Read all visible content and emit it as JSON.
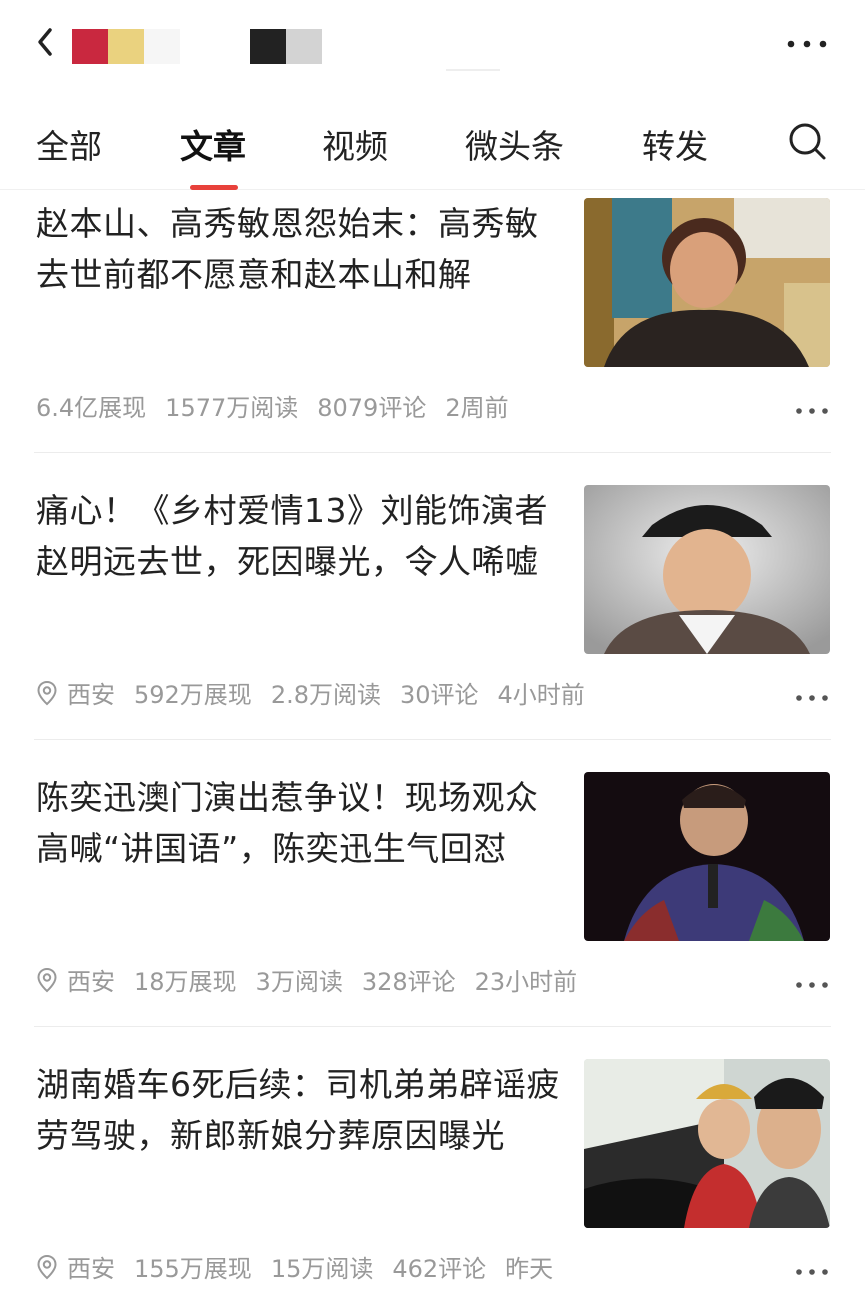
{
  "header": {
    "back_icon": "chevron-left-icon",
    "more_icon": "more-horizontal-icon",
    "swatches": [
      {
        "color": "#c9283f"
      },
      {
        "color": "#ead27f"
      },
      {
        "color": "#f6f6f6"
      },
      {
        "color": "#222222"
      },
      {
        "color": "#d3d3d3"
      }
    ]
  },
  "tabs": [
    {
      "label": "全部"
    },
    {
      "label": "文章",
      "active": true
    },
    {
      "label": "视频"
    },
    {
      "label": "微头条"
    },
    {
      "label": "转发"
    }
  ],
  "accent_color": "#e8413b",
  "articles": [
    {
      "title": "赵本山、高秀敏恩怨始末：高秀敏去世前都不愿意和赵本山和解",
      "location": "",
      "impressions": "6.4亿展现",
      "reads": "1577万阅读",
      "comments": "8079评论",
      "time": "2周前"
    },
    {
      "title": "痛心！《乡村爱情13》刘能饰演者赵明远去世，死因曝光，令人唏嘘",
      "location": "西安",
      "impressions": "592万展现",
      "reads": "2.8万阅读",
      "comments": "30评论",
      "time": "4小时前"
    },
    {
      "title": "陈奕迅澳门演出惹争议！现场观众高喊“讲国语”，陈奕迅生气回怼",
      "location": "西安",
      "impressions": "18万展现",
      "reads": "3万阅读",
      "comments": "328评论",
      "time": "23小时前"
    },
    {
      "title": "湖南婚车6死后续：司机弟弟辟谣疲劳驾驶，新郎新娘分葬原因曝光",
      "location": "西安",
      "impressions": "155万展现",
      "reads": "15万阅读",
      "comments": "462评论",
      "time": "昨天"
    }
  ]
}
